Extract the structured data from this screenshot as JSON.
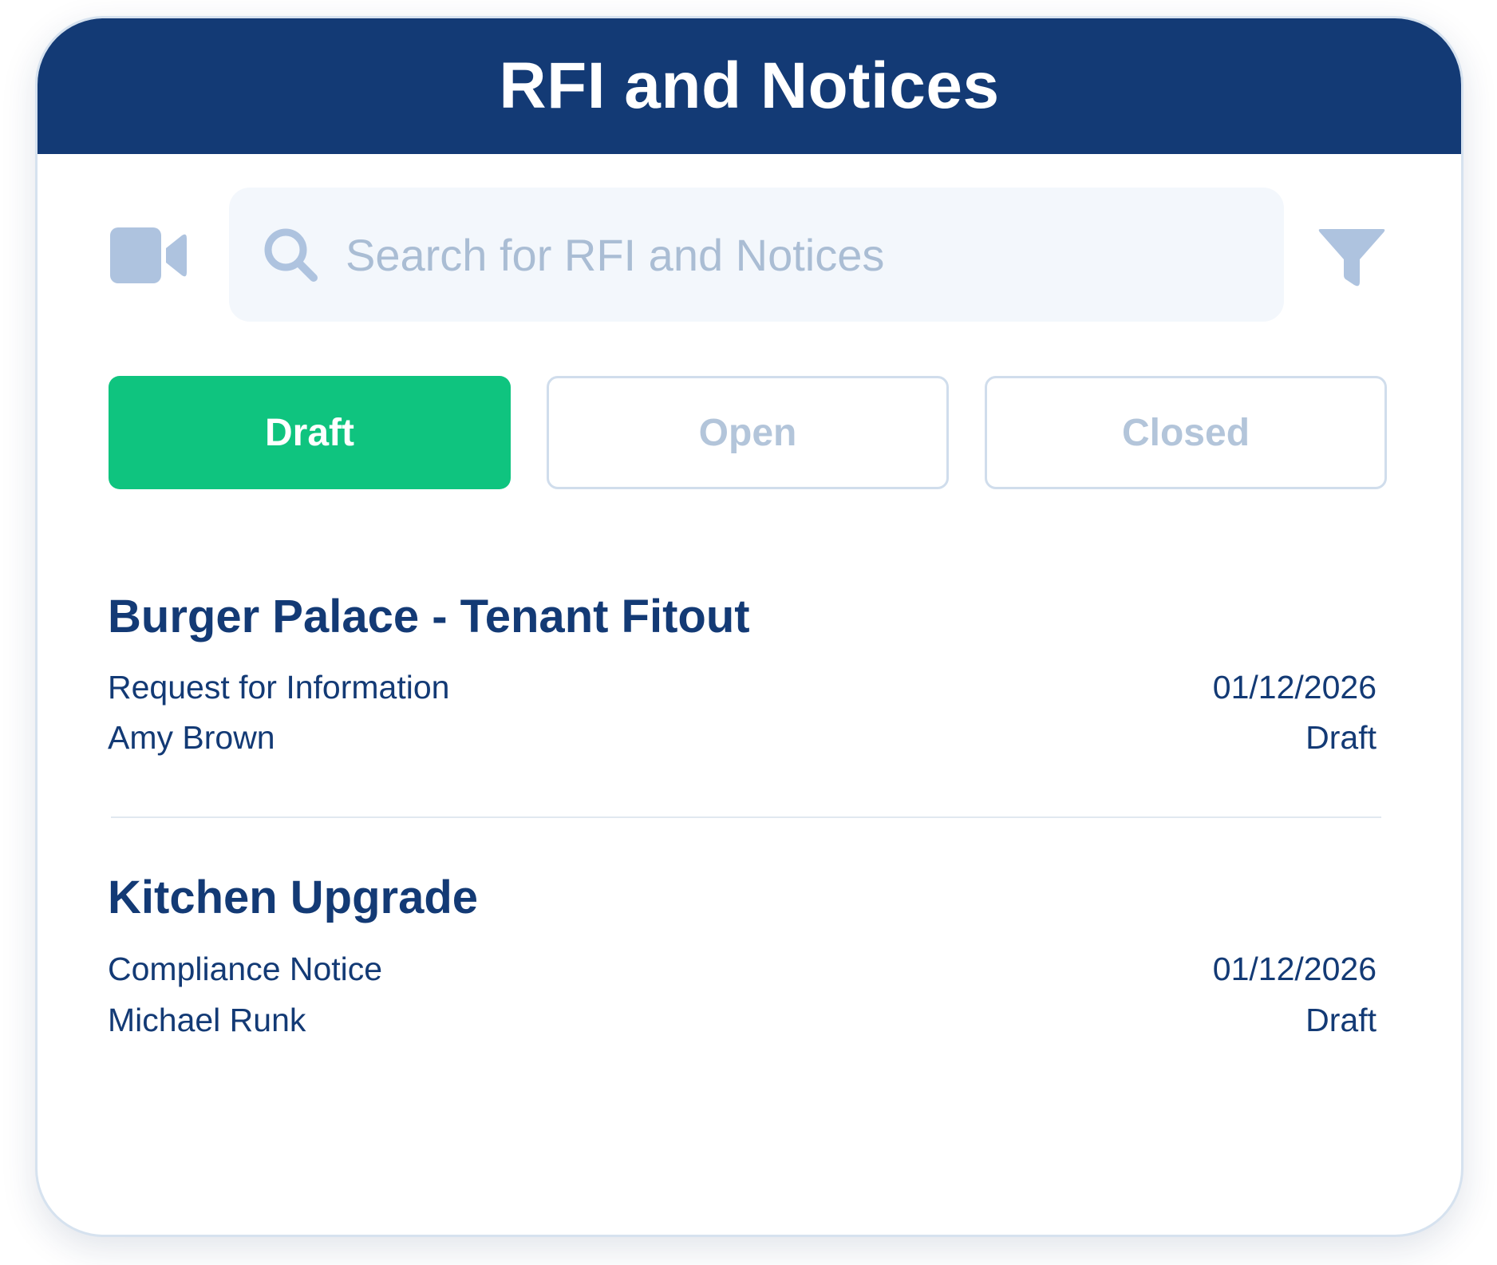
{
  "header": {
    "title": "RFI and Notices"
  },
  "toolbar": {
    "video_icon": "video-camera-icon",
    "filter_icon": "filter-funnel-icon"
  },
  "search": {
    "icon": "search-icon",
    "placeholder": "Search for RFI and Notices"
  },
  "tabs": [
    {
      "label": "Draft",
      "active": true
    },
    {
      "label": "Open",
      "active": false
    },
    {
      "label": "Closed",
      "active": false
    }
  ],
  "items": [
    {
      "title": "Burger Palace - Tenant Fitout",
      "type": "Request for Information",
      "person": "Amy Brown",
      "date": "01/12/2026",
      "status": "Draft"
    },
    {
      "title": "Kitchen Upgrade",
      "type": "Compliance Notice",
      "person": "Michael Runk",
      "date": "01/12/2026",
      "status": "Draft"
    }
  ],
  "colors": {
    "header_bg": "#133a75",
    "accent_green": "#0fc47f",
    "text_primary": "#133a75",
    "muted": "#aabdd4",
    "search_bg": "#f3f7fc",
    "icon_light": "#aec3df"
  }
}
